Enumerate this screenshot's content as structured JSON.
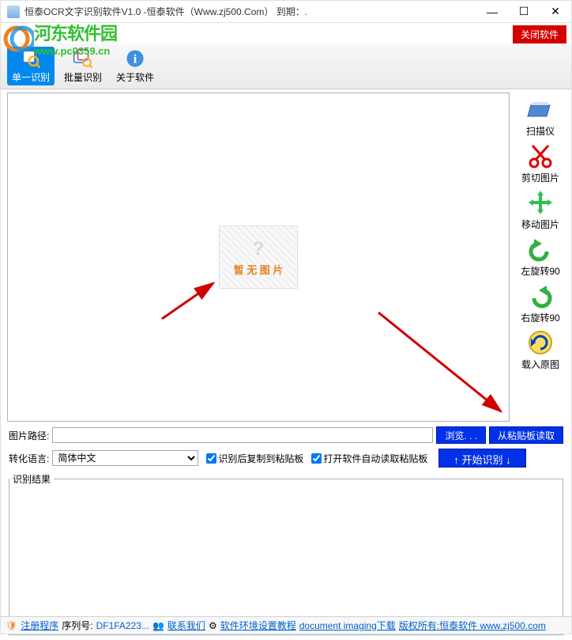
{
  "title": "恒泰OCR文字识别软件V1.0 -恒泰软件（Www.zj500.Com）   到期：.",
  "close_btn": "关闭软件",
  "watermark": {
    "name": "河东软件园",
    "url": "www.pc0359.cn"
  },
  "toolbar": {
    "single": "单一识别",
    "batch": "批量识别",
    "about": "关于软件"
  },
  "preview": {
    "placeholder": "暂 无 图 片"
  },
  "sidebar": {
    "scanner": "扫描仪",
    "crop": "剪切图片",
    "move": "移动图片",
    "rotate_left": "左旋转90",
    "rotate_right": "右旋转90",
    "load_original": "载入原图"
  },
  "controls": {
    "path_label": "图片路径:",
    "path_value": "",
    "browse": "浏览. . .",
    "from_clip": "从粘贴板读取",
    "lang_label": "转化语言:",
    "lang_value": "简体中文",
    "chk_copy": "识别后复制到粘贴板",
    "chk_autoread": "打开软件自动读取粘贴板",
    "start": "↑ 开始识别 ↓",
    "result_label": "识别结果"
  },
  "status": {
    "register": "注册程序",
    "serial_label": "序列号:",
    "serial_value": "DF1FA223...",
    "contact": "联系我们",
    "env": "软件环境设置教程",
    "doc": "document imaging下载",
    "copyright": "版权所有:恒泰软件 www.zj500.com"
  }
}
